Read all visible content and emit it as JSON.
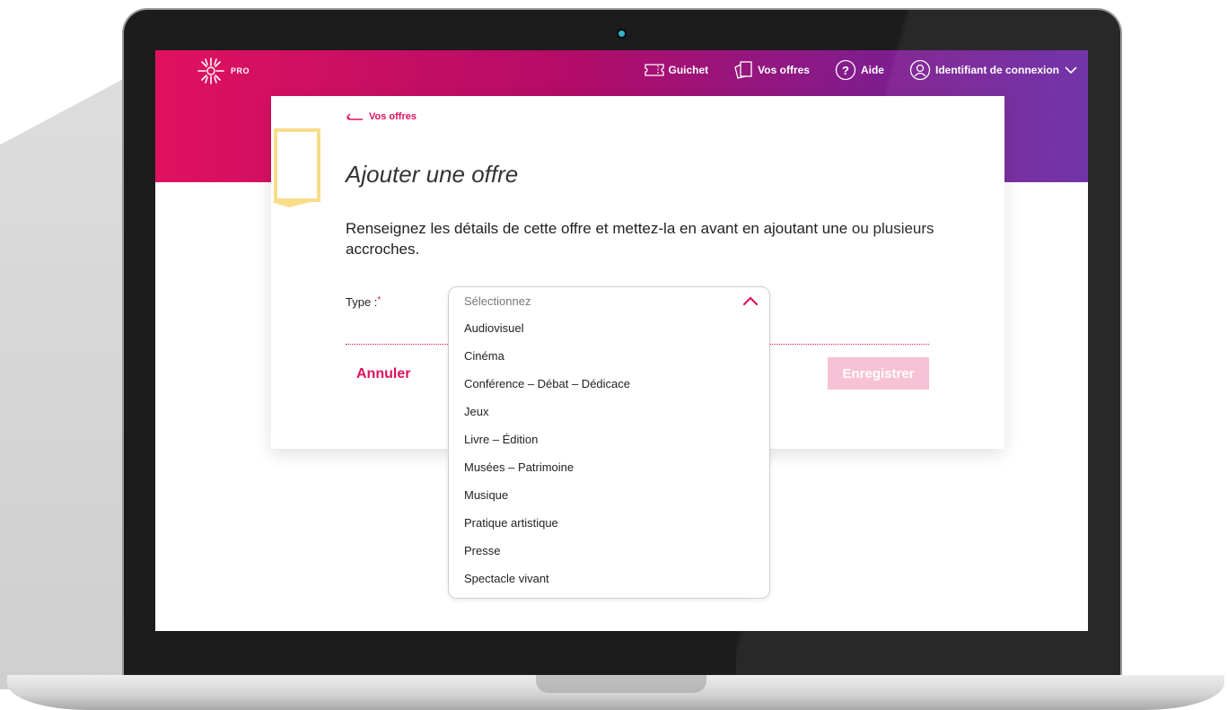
{
  "header": {
    "logo_text": "PRO",
    "nav": [
      {
        "label": "Guichet",
        "icon": "ticket-icon"
      },
      {
        "label": "Vos offres",
        "icon": "offers-icon"
      },
      {
        "label": "Aide",
        "icon": "help-icon"
      },
      {
        "label": "Identifiant de connexion",
        "icon": "user-icon"
      }
    ]
  },
  "card": {
    "back_link": "Vos offres",
    "title": "Ajouter une offre",
    "intro": "Renseignez les détails de cette offre et mettez-la en avant en ajoutant une ou plusieurs accroches.",
    "type_label": "Type :",
    "required_mark": "*",
    "cancel_label": "Annuler",
    "save_label": "Enregistrer"
  },
  "select": {
    "placeholder": "Sélectionnez",
    "options": [
      "Audiovisuel",
      "Cinéma",
      "Conférence – Débat – Dédicace",
      "Jeux",
      "Livre – Édition",
      "Musées – Patrimoine",
      "Musique",
      "Pratique artistique",
      "Presse",
      "Spectacle vivant"
    ]
  },
  "colors": {
    "accent": "#e0115f",
    "gradient_end": "#6a2aa4",
    "save_disabled": "#f7bfd3"
  }
}
